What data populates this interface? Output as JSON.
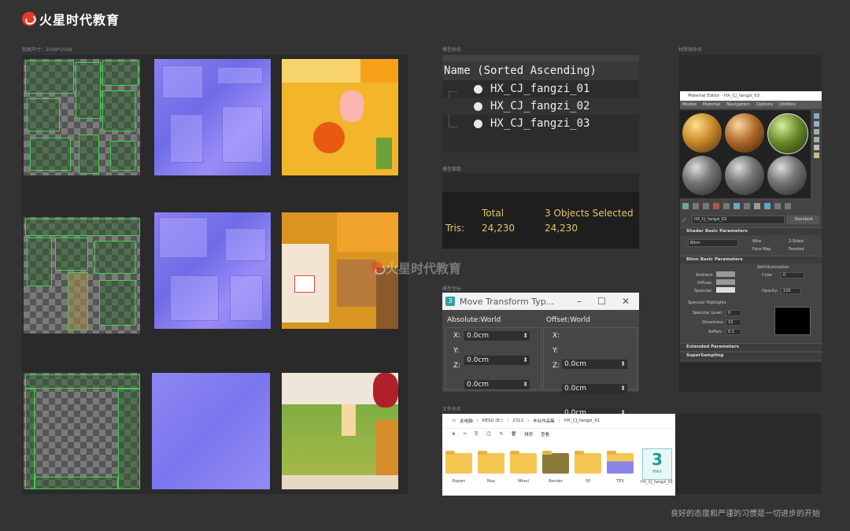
{
  "brand": {
    "name": "火星时代教育"
  },
  "sections": {
    "texture": "贴图尺寸：2048*2048",
    "naming": "模型命名",
    "faces": "模型面数",
    "coords": "模型坐标",
    "files": "文件命名",
    "material": "材质球命名"
  },
  "outliner": {
    "header": "Name (Sorted Ascending)",
    "items": [
      "HX_CJ_fangzi_01",
      "HX_CJ_fangzi_02",
      "HX_CJ_fangzi_03"
    ]
  },
  "stats": {
    "col1_header": "Total",
    "col2_header": "3 Objects Selected",
    "row_label": "Tris:",
    "total": "24,230",
    "selected": "24,230"
  },
  "move_transform": {
    "title": "Move Transform Typ...",
    "absolute_header": "Absolute:World",
    "offset_header": "Offset:World",
    "x_label": "X:",
    "y_label": "Y:",
    "z_label": "Z:",
    "abs_x": "0.0cm",
    "abs_y": "0.0cm",
    "abs_z": "0.0cm",
    "off_x": "0.0cm",
    "off_y": "0.0cm",
    "off_z": "0.0cm"
  },
  "explorer": {
    "path": [
      "此电脑",
      "KESU (E:)",
      "2311",
      "毕业作品集",
      "HX_CJ_fangzi_01"
    ],
    "toolbar": [
      "新建",
      "排序",
      "查看"
    ],
    "items": [
      "Export",
      "Max",
      "Mtool",
      "Render",
      "SP",
      "TEX",
      "HX_CJ_fangzi_01"
    ]
  },
  "material_editor": {
    "title": "Material Editor - HX_CJ_fangzi_03",
    "menu": [
      "Modes",
      "Material",
      "Navigation",
      "Options",
      "Utilities"
    ],
    "mat_name": "HX_CJ_fangzi_03",
    "mat_type": "Standard",
    "rollouts": {
      "shader": "Shader Basic Parameters",
      "blinn": "Blinn Basic Parameters",
      "extended": "Extended Parameters",
      "supersampling": "SuperSampling"
    },
    "shader_type": "Blinn",
    "options": [
      "Wire",
      "2-Sided",
      "Face Map",
      "Faceted"
    ],
    "labels": {
      "self_illum": "Self-Illumination",
      "color": "Color",
      "ambient": "Ambient:",
      "diffuse": "Diffuse:",
      "specular": "Specular:",
      "opacity": "Opacity:",
      "spec_highlights": "Specular Highlights",
      "spec_level": "Specular Level:",
      "glossiness": "Glossiness:",
      "soften": "Soften:"
    },
    "values": {
      "color": "0",
      "opacity": "100",
      "spec_level": "0",
      "glossiness": "10",
      "soften": "0.1"
    }
  },
  "footer": "良好的态度和严谨的习惯是一切进步的开始",
  "colors": {
    "background": "#333333",
    "uv_green": "#3fd14a",
    "accent_red": "#e23b2e"
  }
}
